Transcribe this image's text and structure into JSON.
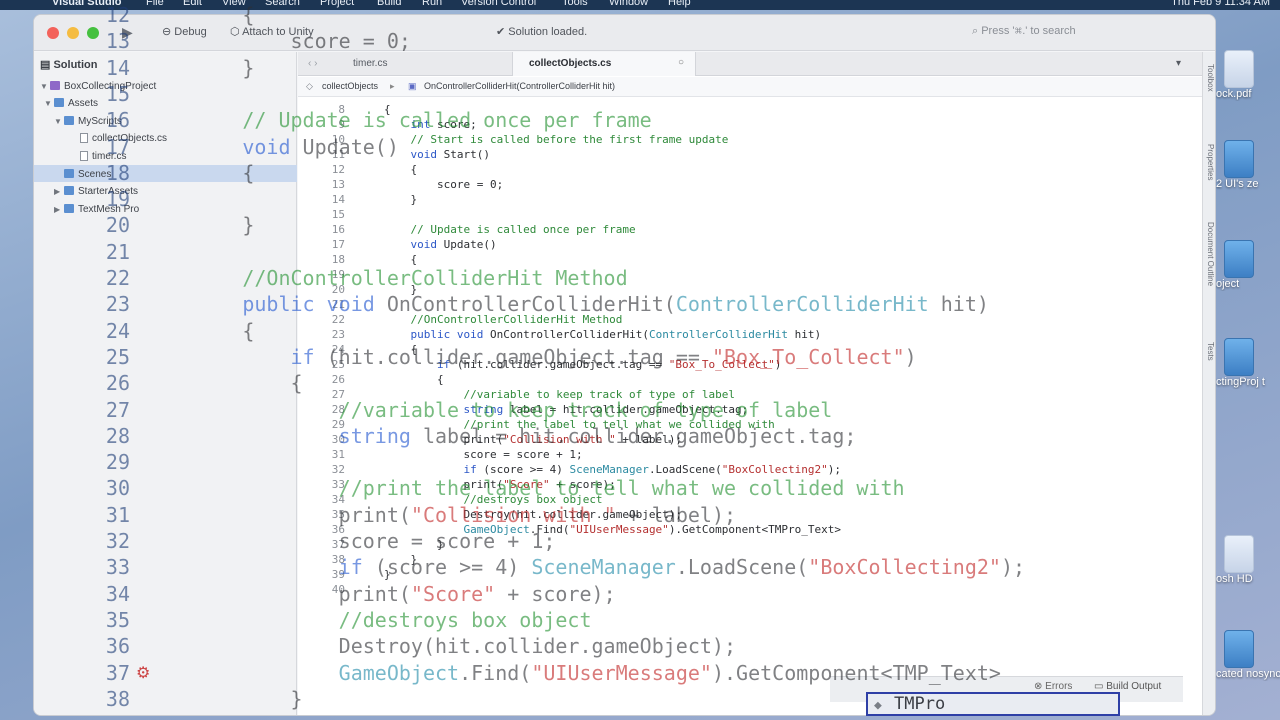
{
  "menubar": {
    "app": "Visual Studio",
    "items": [
      "File",
      "Edit",
      "View",
      "Search",
      "Project",
      "Build",
      "Run",
      "Version Control",
      "Tools",
      "Window",
      "Help"
    ],
    "clock": "Thu Feb 9  11:34 AM"
  },
  "desktop": {
    "items": [
      {
        "label": "ock.pdf",
        "icon": "pdf-file-icon"
      },
      {
        "label": "2 UI's ze",
        "icon": "folder-icon"
      },
      {
        "label": "oject",
        "icon": "folder-icon"
      },
      {
        "label": "ctingProj t",
        "icon": "folder-icon"
      },
      {
        "label": "osh HD",
        "icon": "hard-drive-icon"
      },
      {
        "label": "cated nosync",
        "icon": "folder-icon"
      }
    ]
  },
  "toolbar": {
    "config": "Debug",
    "attach": "Attach to Unity",
    "status": "Solution loaded.",
    "search_placeholder": "Press '⌘.' to search"
  },
  "solution": {
    "title": "Solution",
    "items": [
      {
        "label": "BoxCollectingProject",
        "type": "solution"
      },
      {
        "label": "Assets",
        "type": "folder"
      },
      {
        "label": "MyScripts",
        "type": "folder"
      },
      {
        "label": "collectObjects.cs",
        "type": "file",
        "selected": true
      },
      {
        "label": "timer.cs",
        "type": "file"
      },
      {
        "label": "Scenes",
        "type": "folder"
      },
      {
        "label": "StarterAssets",
        "type": "folder"
      },
      {
        "label": "TextMesh Pro",
        "type": "folder"
      }
    ]
  },
  "tabs": {
    "tab1": "timer.cs",
    "tab2": "collectObjects.cs",
    "close": "○"
  },
  "breadcrumb": {
    "file": "collectObjects",
    "member": "OnControllerColliderHit(ControllerColliderHit hit)"
  },
  "code": {
    "lines": [
      {
        "n": "8",
        "text": "{"
      },
      {
        "n": "9",
        "text": "    int score;"
      },
      {
        "n": "10",
        "text": "    // Start is called before the first frame update"
      },
      {
        "n": "11",
        "text": "    void Start()"
      },
      {
        "n": "12",
        "text": "    {"
      },
      {
        "n": "13",
        "text": "        score = 0;"
      },
      {
        "n": "14",
        "text": "    }"
      },
      {
        "n": "15",
        "text": ""
      },
      {
        "n": "16",
        "text": "    // Update is called once per frame"
      },
      {
        "n": "17",
        "text": "    void Update()"
      },
      {
        "n": "18",
        "text": "    {"
      },
      {
        "n": "19",
        "text": ""
      },
      {
        "n": "20",
        "text": "    }"
      },
      {
        "n": "21",
        "text": ""
      },
      {
        "n": "22",
        "text": "    //OnControllerColliderHit Method"
      },
      {
        "n": "23",
        "text": "    public void OnControllerColliderHit(ControllerColliderHit hit)"
      },
      {
        "n": "24",
        "text": "    {"
      },
      {
        "n": "25",
        "text": "        if (hit.collider.gameObject.tag == \"Box_To_Collect\")"
      },
      {
        "n": "26",
        "text": "        {"
      },
      {
        "n": "27",
        "text": "            //variable to keep track of type of label"
      },
      {
        "n": "28",
        "text": "            string label = hit.collider.gameObject.tag;"
      },
      {
        "n": "29",
        "text": "            //print the label to tell what we collided with"
      },
      {
        "n": "30",
        "text": "            print(\"Collision with \" + label);"
      },
      {
        "n": "31",
        "text": "            score = score + 1;"
      },
      {
        "n": "32",
        "text": "            if (score >= 4) SceneManager.LoadScene(\"BoxCollecting2\");"
      },
      {
        "n": "33",
        "text": "            print(\"Score\" + score);"
      },
      {
        "n": "34",
        "text": "            //destroys box object"
      },
      {
        "n": "35",
        "text": "            Destroy(hit.collider.gameObject);"
      },
      {
        "n": "36",
        "text": "            GameObject.Find(\"UIUserMessage\").GetComponent<TMPro_Text>"
      },
      {
        "n": "37",
        "text": "        }"
      },
      {
        "n": "38",
        "text": "    }"
      },
      {
        "n": "39",
        "text": "}"
      },
      {
        "n": "40",
        "text": ""
      }
    ]
  },
  "zoom": {
    "lines": [
      {
        "n": "12",
        "text": "        {"
      },
      {
        "n": "13",
        "text": "            score = 0;"
      },
      {
        "n": "14",
        "text": "        }"
      },
      {
        "n": "15",
        "text": ""
      },
      {
        "n": "16",
        "text": "        // Update is called once per frame"
      },
      {
        "n": "17",
        "text": "        void Update()"
      },
      {
        "n": "18",
        "text": "        {"
      },
      {
        "n": "19",
        "text": ""
      },
      {
        "n": "20",
        "text": "        }"
      },
      {
        "n": "21",
        "text": ""
      },
      {
        "n": "22",
        "text": "        //OnControllerColliderHit Method"
      },
      {
        "n": "23",
        "text": "        public void OnControllerColliderHit(ControllerColliderHit hit)"
      },
      {
        "n": "24",
        "text": "        {"
      },
      {
        "n": "25",
        "text": "            if (hit.collider.gameObject.tag == \"Box_To_Collect\")"
      },
      {
        "n": "26",
        "text": "            {"
      },
      {
        "n": "27",
        "text": "                //variable to keep track of type of label"
      },
      {
        "n": "28",
        "text": "                string label = hit.collider.gameObject.tag;"
      },
      {
        "n": "29",
        "text": ""
      },
      {
        "n": "30",
        "text": "                //print the label to tell what we collided with"
      },
      {
        "n": "31",
        "text": "                print(\"Collision with \" + label);"
      },
      {
        "n": "32",
        "text": "                score = score + 1;"
      },
      {
        "n": "33",
        "text": "                if (score >= 4) SceneManager.LoadScene(\"BoxCollecting2\");"
      },
      {
        "n": "34",
        "text": "                print(\"Score\" + score);"
      },
      {
        "n": "35",
        "text": "                //destroys box object"
      },
      {
        "n": "36",
        "text": "                Destroy(hit.collider.gameObject);"
      },
      {
        "n": "37",
        "text": "                GameObject.Find(\"UIUserMessage\").GetComponent<TMP_Text>"
      },
      {
        "n": "38",
        "text": "            }"
      }
    ],
    "autocomplete": "TMPro"
  },
  "right_panels": [
    "Toolbox",
    "Properties",
    "Document Outline",
    "Tests"
  ],
  "bottom": {
    "errors": "Errors",
    "build_output": "Build Output"
  }
}
